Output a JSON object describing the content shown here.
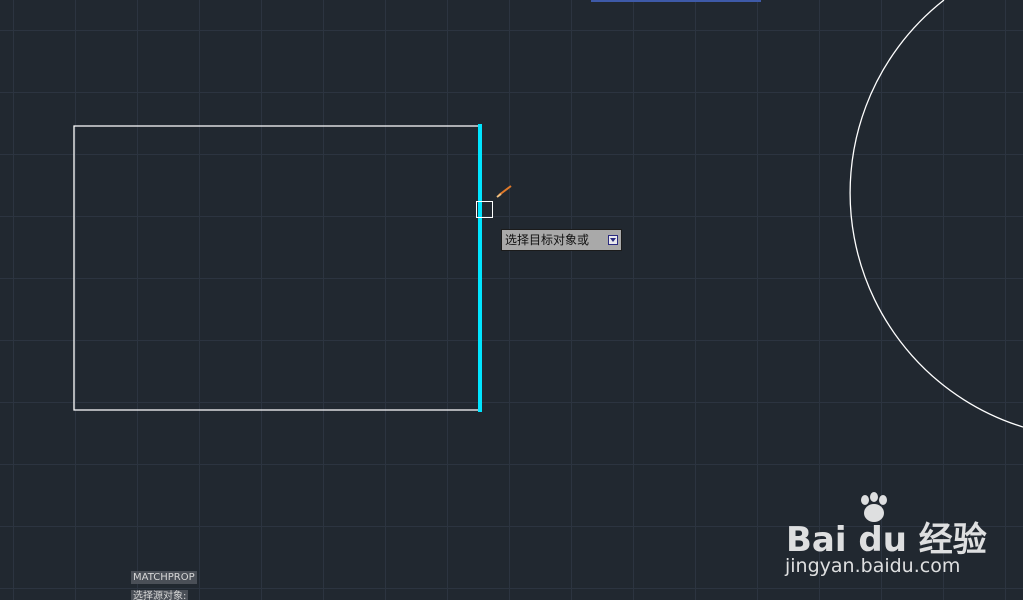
{
  "tooltip": {
    "text": "选择目标对象或",
    "dropdown_icon": "arrow-down-icon"
  },
  "command_line": {
    "history": [
      {
        "text": "MATCHPROP"
      },
      {
        "text": "选择源对象:"
      }
    ]
  },
  "watermark": {
    "logo": "Bai du 经验",
    "url": "jingyan.baidu.com"
  },
  "colors": {
    "background": "#212830",
    "grid": "#2c3440",
    "geometry": "#ffffff",
    "selected_line": "#00e5ff",
    "cursor": "#e07a2a"
  }
}
